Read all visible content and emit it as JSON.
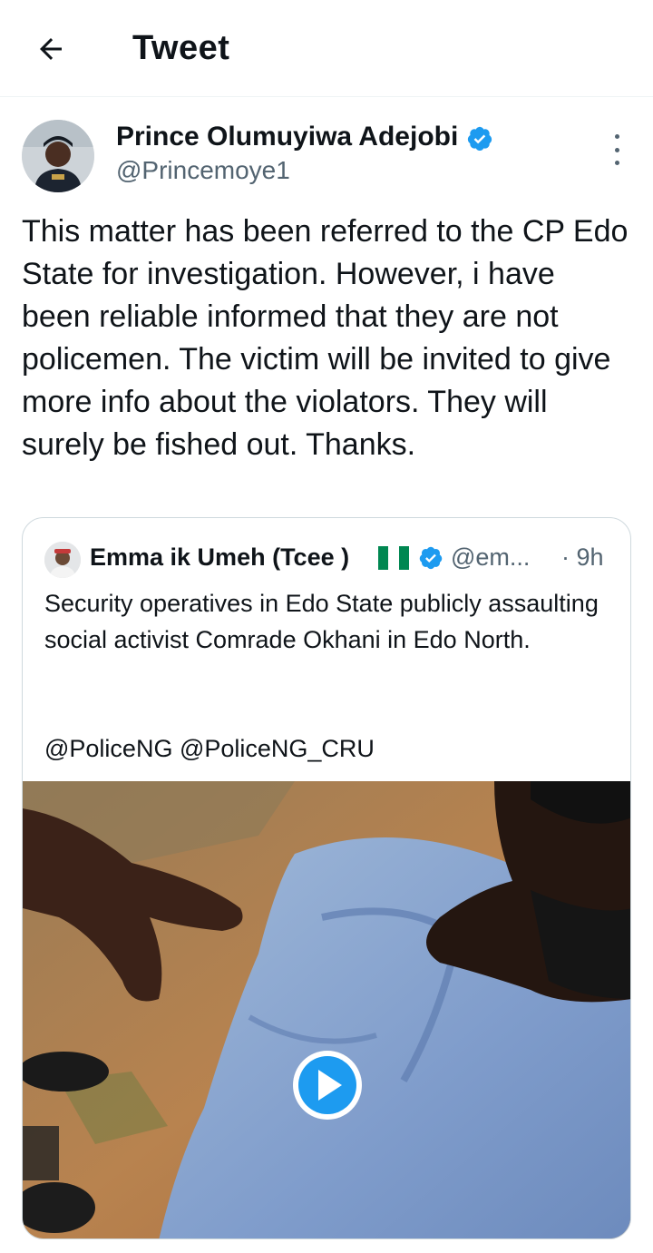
{
  "header": {
    "title": "Tweet",
    "back_icon": "arrow-left-icon"
  },
  "tweet": {
    "author_name": "Prince Olumuyiwa Adejobi",
    "handle": "@Princemoye1",
    "verified": true,
    "text": "This matter has been referred to the CP Edo State for investigation. However, i have been reliable informed that they are not policemen. The victim will be invited to give more info about the violators. They will surely be fished out. Thanks."
  },
  "quoted_tweet": {
    "author_name": "Emma ik Umeh (Tcee )",
    "flag": "Nigeria flag",
    "handle": "@em...",
    "time": "· 9h",
    "text": "Security operatives in Edo State publicly assaulting social activist Comrade Okhani in Edo North.",
    "mentions": "@PoliceNG @PoliceNG_CRU",
    "media": {
      "type": "video",
      "play_icon": "play-icon"
    }
  },
  "colors": {
    "accent": "#1d9bf0",
    "text": "#0f1419",
    "secondary": "#536471",
    "border": "#cfd9de",
    "flag_green": "#008751"
  }
}
